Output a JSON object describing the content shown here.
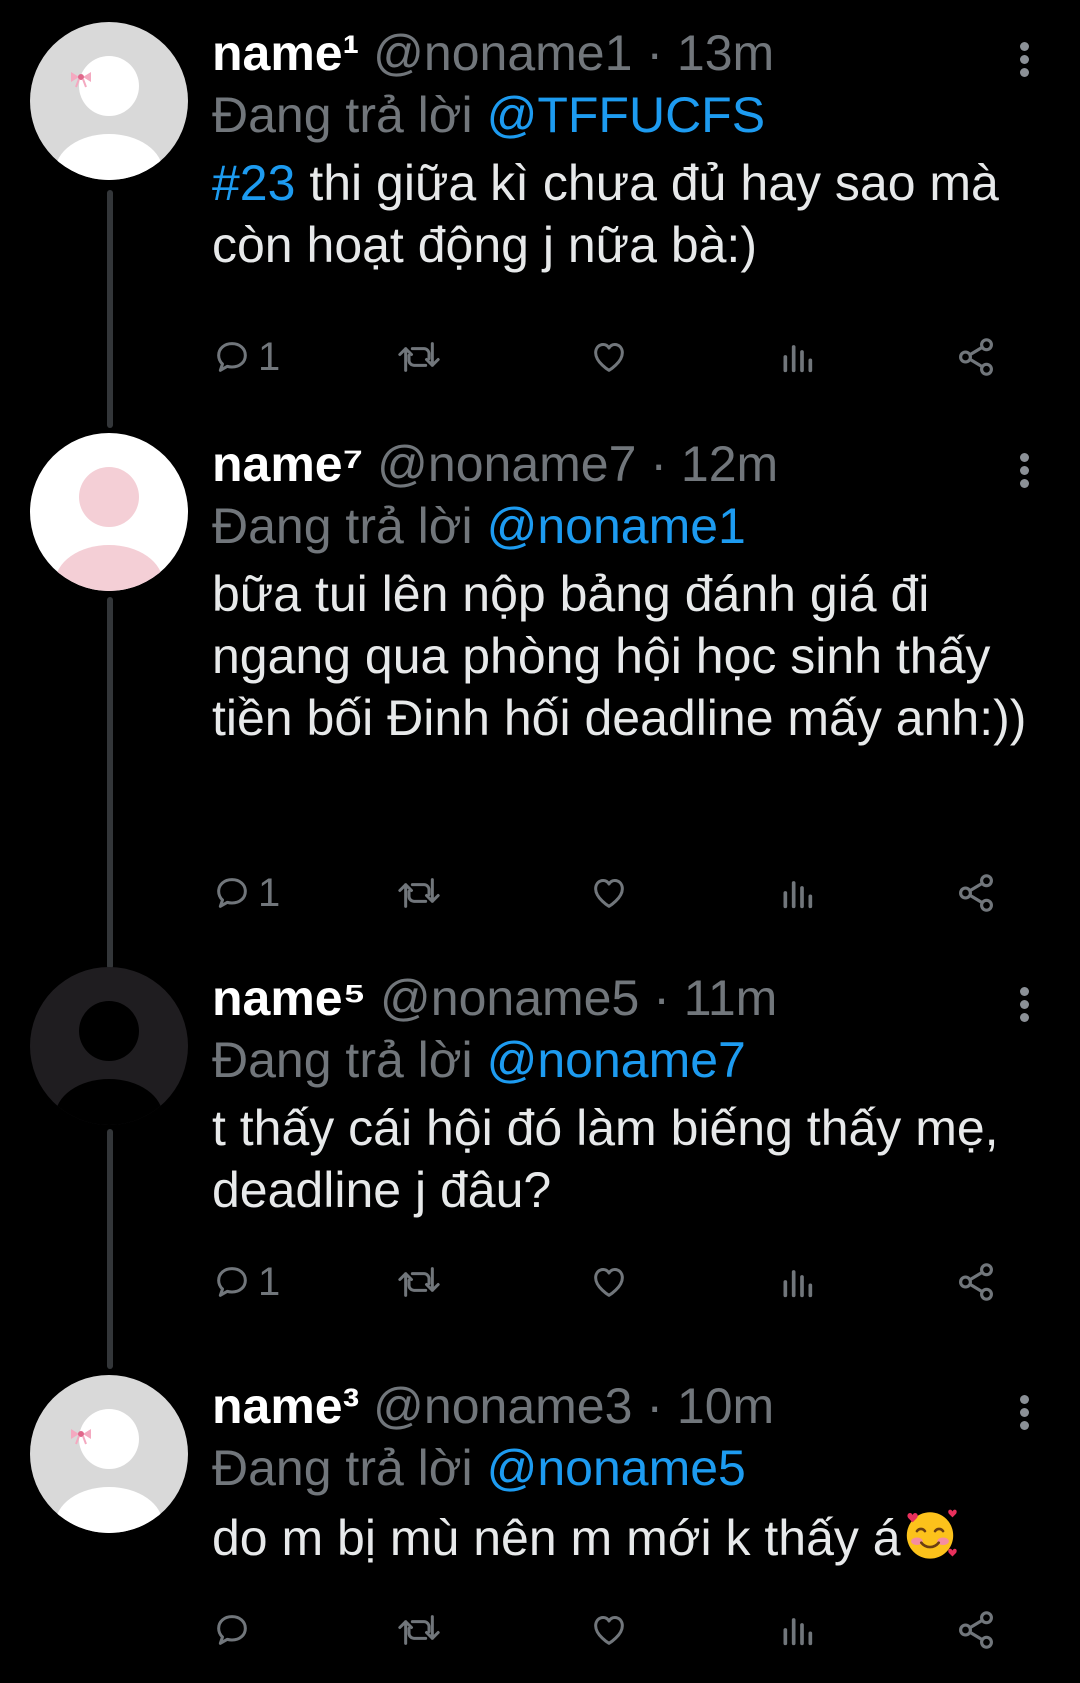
{
  "colors": {
    "background": "#000000",
    "text": "#e7e9ea",
    "secondary": "#71767b",
    "accent": "#1d9bf0",
    "thread_line": "#333639"
  },
  "reply_prefix": "Đang trả lời",
  "dot": "·",
  "tweets": [
    {
      "avatar": "default-avatar-gray-with-bow-icon",
      "name": "name¹",
      "handle": "@noname1",
      "time": "13m",
      "reply_to": "@TFFUCFS",
      "hashtag": "#23",
      "text": " thi giữa kì chưa đủ hay sao mà còn hoạt động j nữa bà:)",
      "reply_count": "1"
    },
    {
      "avatar": "default-avatar-pink-icon",
      "name": "name⁷",
      "handle": "@noname7",
      "time": "12m",
      "reply_to": "@noname1",
      "text": "bữa tui lên nộp bảng đánh giá đi ngang qua phòng hội học sinh thấy tiền bối Đinh hối deadline mấy anh:))",
      "reply_count": "1"
    },
    {
      "avatar": "default-avatar-dark-icon",
      "name": "name⁵",
      "handle": "@noname5",
      "time": "11m",
      "reply_to": "@noname7",
      "text": "t thấy cái hội đó làm biếng thấy mẹ, deadline j đâu?",
      "reply_count": "1"
    },
    {
      "avatar": "default-avatar-gray-with-bow-icon",
      "name": "name³",
      "handle": "@noname3",
      "time": "10m",
      "reply_to": "@noname5",
      "text": "do m bị mù nên m mới k thấy á",
      "emoji": "smiling-face-with-hearts-emoji",
      "reply_count": ""
    }
  ]
}
